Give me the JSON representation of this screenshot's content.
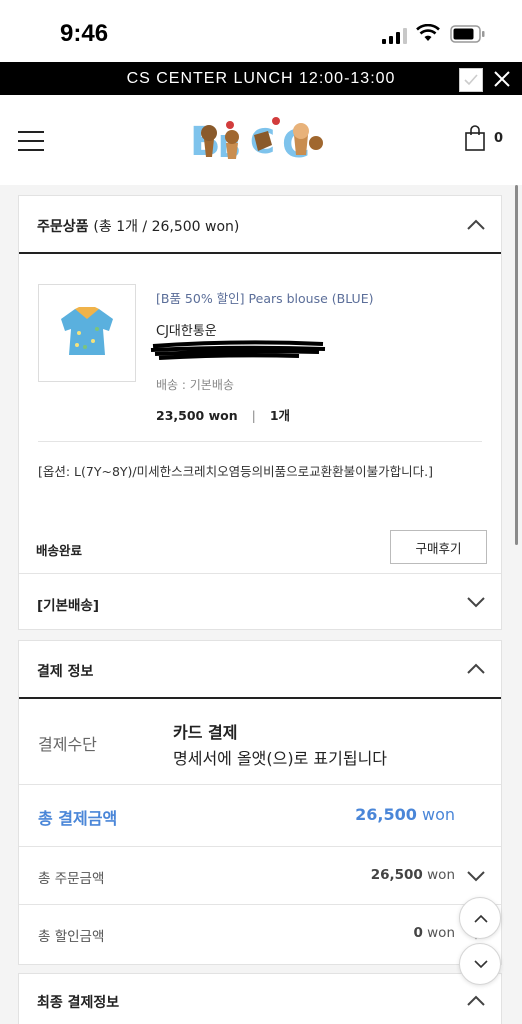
{
  "status_bar": {
    "time": "9:46"
  },
  "banner": {
    "text": "CS CENTER LUNCH 12:00-13:00"
  },
  "header": {
    "logo_alt": "BBCC",
    "cart_count": "0"
  },
  "order_section": {
    "title": "주문상품",
    "summary": "(총 1개 / 26,500 won)",
    "product": {
      "name": "[B품 50% 할인] Pears blouse (BLUE)",
      "courier": "CJ대한통운",
      "shipping_label": "배송 : 기본배송",
      "price": "23,500 won",
      "qty": "1개",
      "option": "[옵션: L(7Y~8Y)/미세한스크레치오염등의비품으로교환환불이불가합니다.]"
    },
    "status": "배송완료",
    "review_button": "구매후기",
    "shipping_group": "[기본배송]"
  },
  "payment_section": {
    "title": "결제 정보",
    "method_label": "결제수단",
    "method_value": "카드 결제",
    "method_note": "명세서에 올앳(으)로 표기됩니다",
    "total_label": "총 결제금액",
    "total_value": "26,500",
    "total_unit": "won",
    "order_amount_label": "총 주문금액",
    "order_amount_value": "26,500",
    "order_amount_unit": "won",
    "discount_label": "총 할인금액",
    "discount_value": "0",
    "discount_unit": "won"
  },
  "final_section": {
    "title": "최종 결제정보"
  },
  "colors": {
    "accent": "#4a86d8",
    "banner": "#000000",
    "link": "#5b6e99"
  }
}
